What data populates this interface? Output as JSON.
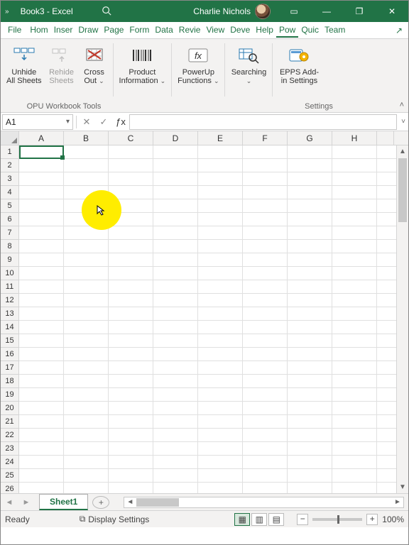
{
  "title": {
    "doc": "Book3",
    "sep": "  -  ",
    "app": "Excel"
  },
  "user": {
    "name": "Charlie Nichols"
  },
  "window_buttons": {
    "ribbon_opts": "▭",
    "min": "—",
    "restore": "❐",
    "close": "✕"
  },
  "menu": {
    "file": "File",
    "tabs": [
      "Hom",
      "Inser",
      "Draw",
      "Page",
      "Form",
      "Data",
      "Revie",
      "View",
      "Deve",
      "Help",
      "Pow",
      "Quic",
      "Team"
    ],
    "active_index": 10,
    "share_icon": "↗"
  },
  "ribbon": {
    "groups": {
      "opu": {
        "label": "OPU Workbook Tools",
        "unhide": {
          "l1": "Unhide",
          "l2": "All Sheets"
        },
        "rehide": {
          "l1": "Rehide",
          "l2": "Sheets"
        },
        "crossout": {
          "l1": "Cross",
          "l2": "Out",
          "dd": "⌄"
        }
      },
      "product": {
        "l1": "Product",
        "l2": "Information",
        "dd": "⌄"
      },
      "powerup": {
        "l1": "PowerUp",
        "l2": "Functions",
        "dd": "⌄"
      },
      "search": {
        "l1": "Searching",
        "l2": "",
        "dd": "⌄"
      },
      "epps": {
        "l1": "EPPS Add-",
        "l2": "in Settings"
      },
      "settings_label": "Settings"
    },
    "collapse": "˄"
  },
  "formula_bar": {
    "namebox": "A1",
    "namebox_dd": "▾",
    "cancel": "✕",
    "enter": "✓",
    "fx": "ƒx",
    "formula": "",
    "expand": "˅"
  },
  "grid": {
    "columns": [
      "A",
      "B",
      "C",
      "D",
      "E",
      "F",
      "G",
      "H"
    ],
    "row_count": 26,
    "selected_cell": "A1",
    "scroll": {
      "up": "▲",
      "down": "▼"
    }
  },
  "cursor_spot": {
    "col": "B",
    "rows": "4-5"
  },
  "sheet_tabs": {
    "prev": "◄",
    "next": "►",
    "active": "Sheet1",
    "add": "+",
    "hscroll": {
      "left": "◄",
      "right": "►"
    }
  },
  "status": {
    "state": "Ready",
    "accessibility_icon": "☐",
    "display_settings": "Display Settings",
    "views": {
      "normal": "▦",
      "layout": "▥",
      "pagebreak": "▤"
    },
    "zoom": {
      "minus": "−",
      "plus": "+",
      "value": "100%"
    }
  },
  "colors": {
    "accent": "#217346",
    "highlight": "#ffed00"
  }
}
